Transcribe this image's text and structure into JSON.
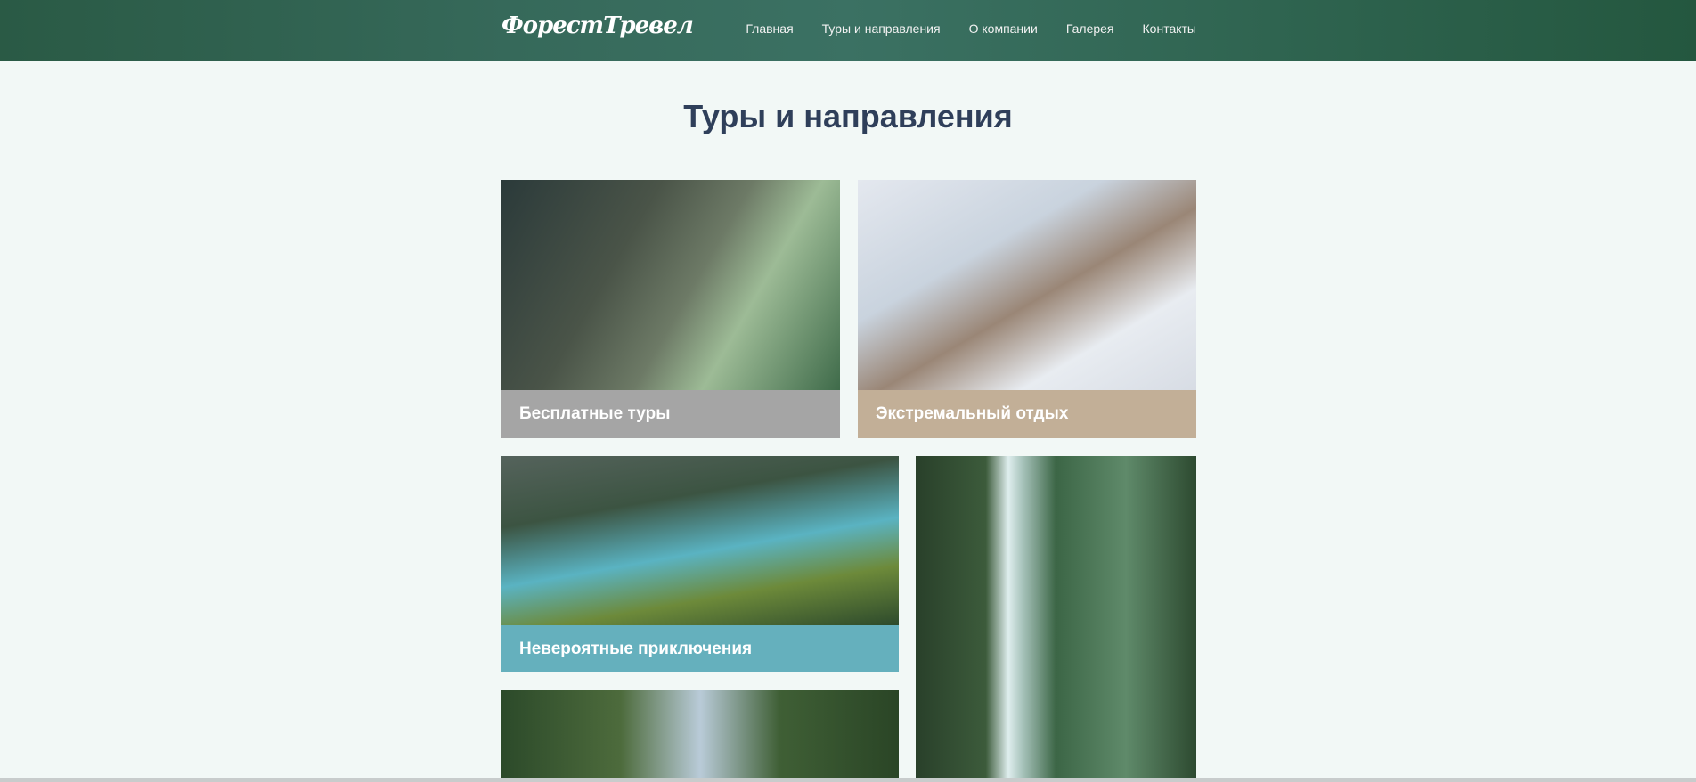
{
  "header": {
    "logo": "ФорестТревел",
    "nav": [
      "Главная",
      "Туры и направления",
      "О компании",
      "Галерея",
      "Контакты"
    ]
  },
  "page_title": "Туры и направления",
  "cards": [
    {
      "title": "Бесплатные туры",
      "color": "#a5a5a5"
    },
    {
      "title": "Экстремальный отдых",
      "color": "#c2af97"
    },
    {
      "title": "Невероятные приключения",
      "color": "#65b0bd"
    }
  ]
}
